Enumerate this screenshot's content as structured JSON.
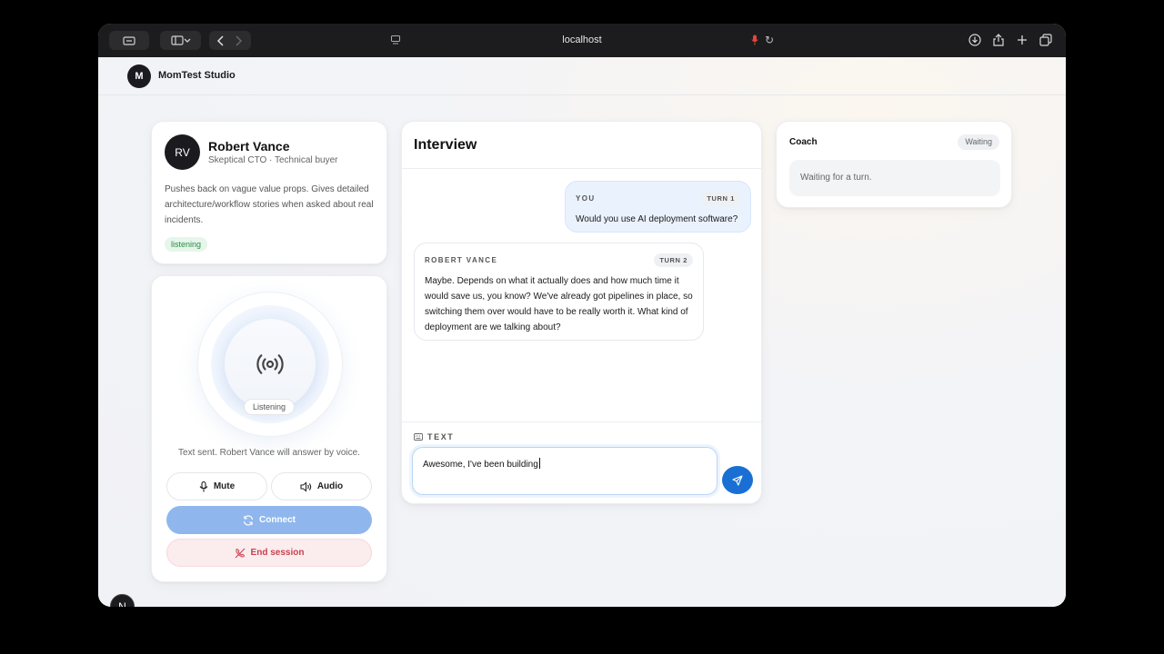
{
  "browser": {
    "url": "localhost"
  },
  "app": {
    "logo_letter": "M",
    "brand": "MomTest Studio",
    "fab_letter": "N"
  },
  "persona": {
    "initials": "RV",
    "name": "Robert Vance",
    "role": "Skeptical CTO · Technical buyer",
    "description": "Pushes back on vague value props. Gives detailed architecture/workflow stories when asked about real incidents.",
    "status": "listening"
  },
  "voice": {
    "orb_state": "Listening",
    "status_text": "Text sent. Robert Vance will answer by voice.",
    "mute_label": "Mute",
    "audio_label": "Audio",
    "connect_label": "Connect",
    "end_label": "End session"
  },
  "interview": {
    "title": "Interview",
    "messages": [
      {
        "speaker": "YOU",
        "turn": "TURN 1",
        "text": "Would you use AI deployment software?"
      },
      {
        "speaker": "ROBERT VANCE",
        "turn": "TURN 2",
        "text": "Maybe. Depends on what it actually does and how much time it would save us, you know? We've already got pipelines in place, so switching them over would have to be really worth it. What kind of deployment are we talking about?"
      }
    ],
    "input_label": "TEXT",
    "input_value": "Awesome, I've been building"
  },
  "coach": {
    "title": "Coach",
    "status": "Waiting",
    "message": "Waiting for a turn."
  },
  "colors": {
    "accent": "#1a6fd4",
    "connect": "#8fb7ee",
    "danger": "#c8414f",
    "listening": "#2d8a47"
  }
}
